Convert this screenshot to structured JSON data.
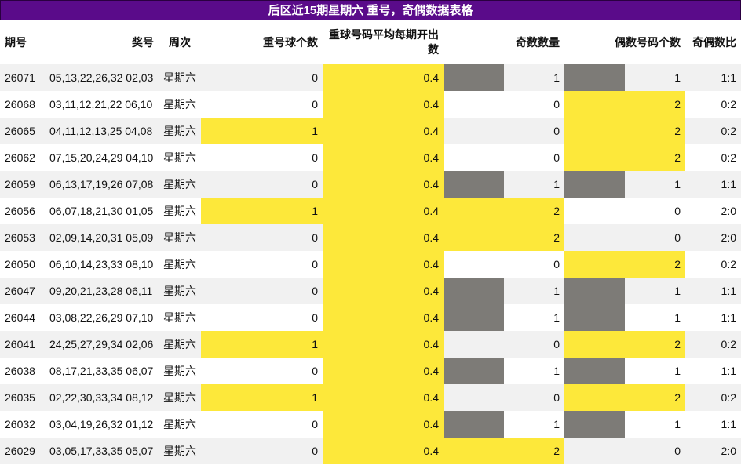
{
  "title": "后区近15期星期六 重号，奇偶数据表格",
  "headers": {
    "issue": "期号",
    "numbers": "奖号",
    "weekday": "周次",
    "repeat_count": "重号球个数",
    "repeat_avg": "重球号码平均每期开出数",
    "odd_count": "奇数数量",
    "even_count": "偶数号码个数",
    "ratio": "奇偶数比"
  },
  "colors": {
    "title_bg": "#5a0b8a",
    "highlight": "#fde83a",
    "neutral": "#7d7b77",
    "row_alt": "#f1f1f1"
  },
  "rows": [
    {
      "issue": "26071",
      "numbers": "05,13,22,26,32 02,03",
      "weekday": "星期六",
      "repeat": "0",
      "avg": "0.4",
      "odd": "1",
      "even": "1",
      "ratio": "1:1"
    },
    {
      "issue": "26068",
      "numbers": "03,11,12,21,22 06,10",
      "weekday": "星期六",
      "repeat": "0",
      "avg": "0.4",
      "odd": "0",
      "even": "2",
      "ratio": "0:2"
    },
    {
      "issue": "26065",
      "numbers": "04,11,12,13,25 04,08",
      "weekday": "星期六",
      "repeat": "1",
      "avg": "0.4",
      "odd": "0",
      "even": "2",
      "ratio": "0:2"
    },
    {
      "issue": "26062",
      "numbers": "07,15,20,24,29 04,10",
      "weekday": "星期六",
      "repeat": "0",
      "avg": "0.4",
      "odd": "0",
      "even": "2",
      "ratio": "0:2"
    },
    {
      "issue": "26059",
      "numbers": "06,13,17,19,26 07,08",
      "weekday": "星期六",
      "repeat": "0",
      "avg": "0.4",
      "odd": "1",
      "even": "1",
      "ratio": "1:1"
    },
    {
      "issue": "26056",
      "numbers": "06,07,18,21,30 01,05",
      "weekday": "星期六",
      "repeat": "1",
      "avg": "0.4",
      "odd": "2",
      "even": "0",
      "ratio": "2:0"
    },
    {
      "issue": "26053",
      "numbers": "02,09,14,20,31 05,09",
      "weekday": "星期六",
      "repeat": "0",
      "avg": "0.4",
      "odd": "2",
      "even": "0",
      "ratio": "2:0"
    },
    {
      "issue": "26050",
      "numbers": "06,10,14,23,33 08,10",
      "weekday": "星期六",
      "repeat": "0",
      "avg": "0.4",
      "odd": "0",
      "even": "2",
      "ratio": "0:2"
    },
    {
      "issue": "26047",
      "numbers": "09,20,21,23,28 06,11",
      "weekday": "星期六",
      "repeat": "0",
      "avg": "0.4",
      "odd": "1",
      "even": "1",
      "ratio": "1:1"
    },
    {
      "issue": "26044",
      "numbers": "03,08,22,26,29 07,10",
      "weekday": "星期六",
      "repeat": "0",
      "avg": "0.4",
      "odd": "1",
      "even": "1",
      "ratio": "1:1"
    },
    {
      "issue": "26041",
      "numbers": "24,25,27,29,34 02,06",
      "weekday": "星期六",
      "repeat": "1",
      "avg": "0.4",
      "odd": "0",
      "even": "2",
      "ratio": "0:2"
    },
    {
      "issue": "26038",
      "numbers": "08,17,21,33,35 06,07",
      "weekday": "星期六",
      "repeat": "0",
      "avg": "0.4",
      "odd": "1",
      "even": "1",
      "ratio": "1:1"
    },
    {
      "issue": "26035",
      "numbers": "02,22,30,33,34 08,12",
      "weekday": "星期六",
      "repeat": "1",
      "avg": "0.4",
      "odd": "0",
      "even": "2",
      "ratio": "0:2"
    },
    {
      "issue": "26032",
      "numbers": "03,04,19,26,32 01,12",
      "weekday": "星期六",
      "repeat": "0",
      "avg": "0.4",
      "odd": "1",
      "even": "1",
      "ratio": "1:1"
    },
    {
      "issue": "26029",
      "numbers": "03,05,17,33,35 05,07",
      "weekday": "星期六",
      "repeat": "0",
      "avg": "0.4",
      "odd": "2",
      "even": "0",
      "ratio": "2:0"
    }
  ]
}
